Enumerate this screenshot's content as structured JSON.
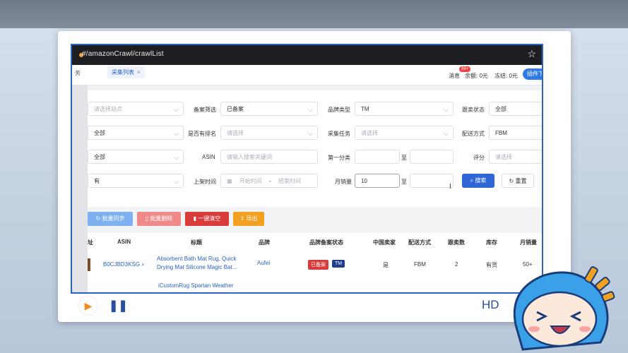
{
  "browser": {
    "url": "#/amazonCrawl/crawlList"
  },
  "tabs": [
    {
      "label": "务"
    },
    {
      "label": "采集列表",
      "close": "×"
    }
  ],
  "header": {
    "messages": "消息",
    "badge": "99+",
    "balance": "余额: 0元",
    "frozen": "冻结: 0元",
    "plugin": "插件下"
  },
  "filters": {
    "site_placeholder": "请选择站点",
    "record_label": "备案筛选",
    "record_value": "已备案",
    "brand_type_label": "品牌类型",
    "brand_type_value": "TM",
    "follow_label": "跟卖状态",
    "follow_value": "全部",
    "row2_first": "全部",
    "rank_label": "是否有排名",
    "rank_placeholder": "请选择",
    "task_label": "采集任务",
    "task_placeholder": "请选择",
    "ship_label": "配送方式",
    "ship_value": "FBM",
    "row3_first": "全部",
    "asin_label": "ASIN",
    "asin_placeholder": "请输入搜索关键词",
    "cat_label": "第一分类",
    "to": "至",
    "score_label": "评分",
    "score_placeholder": "请选择",
    "row4_first": "有",
    "date_label": "上架时间",
    "date_start": "开始时间",
    "date_dash": "-",
    "date_end": "结束时间",
    "sales_label": "月销量",
    "sales_value": "10",
    "search": "搜索",
    "reset": "重置"
  },
  "actions": {
    "sync": "批量同步",
    "delete": "批量删除",
    "clear": "一键清空",
    "export": "导出"
  },
  "table": {
    "headers": [
      "址",
      "ASIN",
      "标题",
      "品牌",
      "品牌备案状态",
      "中国卖家",
      "配送方式",
      "跟卖数",
      "库存",
      "月销量"
    ],
    "row": {
      "asin": "B0CJBD3KSG",
      "title1": "Absorbent Bath Mat Rug, Quick",
      "title2": "Drying Mat Silicone Magic Bat...",
      "brand": "Aufei",
      "tag1": "已备案",
      "tag2": "TM",
      "cn": "是",
      "ship": "FBM",
      "follow": "2",
      "stock": "有货",
      "sales": "50+"
    },
    "row2_title": "iCustomRug Spartan Weather"
  },
  "player": {
    "hd": "HD"
  },
  "colors": {
    "accent": "#2e66d6",
    "danger": "#d93b3b",
    "pink": "#f08a8a",
    "orange": "#f2a01f",
    "sync": "#7fb0f0"
  }
}
